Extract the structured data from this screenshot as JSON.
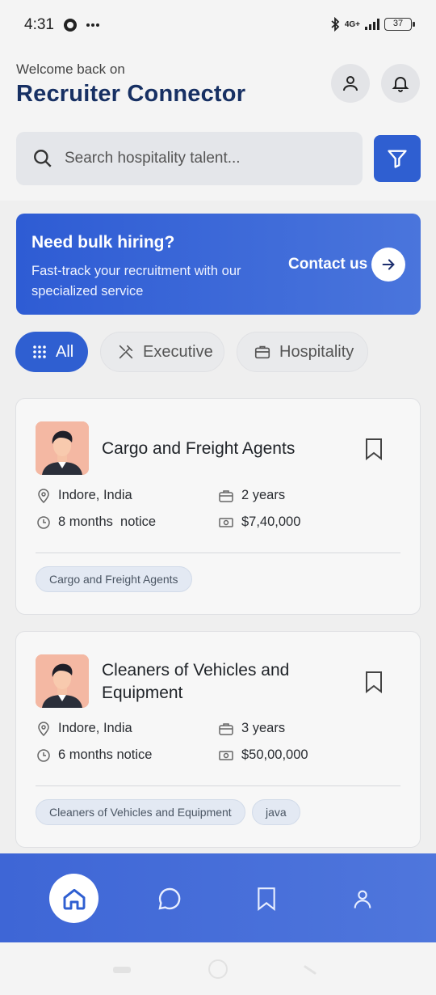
{
  "status": {
    "time": "4:31",
    "network": "4G+",
    "battery": "37"
  },
  "header": {
    "welcome": "Welcome back on",
    "title": "Recruiter Connector"
  },
  "search": {
    "placeholder": "Search hospitality talent..."
  },
  "banner": {
    "title": "Need bulk hiring?",
    "text": "Fast-track your recruitment with our specialized service",
    "cta": "Contact us"
  },
  "filters": [
    {
      "label": "All",
      "icon": "grid-icon",
      "active": true
    },
    {
      "label": "Executive",
      "icon": "utensils-icon",
      "active": false
    },
    {
      "label": "Hospitality",
      "icon": "briefcase-icon",
      "active": false
    }
  ],
  "candidates": [
    {
      "title": "Cargo and Freight Agents",
      "location": "Indore, India",
      "experience": "2 years",
      "notice": "8 months  notice",
      "salary": "$7,40,000",
      "tags": [
        "Cargo and Freight Agents"
      ]
    },
    {
      "title": "Cleaners of Vehicles and Equipment",
      "location": "Indore, India",
      "experience": "3 years",
      "notice": "6 months notice",
      "salary": "$50,00,000",
      "tags": [
        "Cleaners of Vehicles and Equipment",
        "java"
      ]
    }
  ],
  "nav": [
    "home-icon",
    "chat-icon",
    "bookmark-icon",
    "profile-icon"
  ],
  "colors": {
    "primary": "#2f5fd1",
    "title": "#173063"
  }
}
